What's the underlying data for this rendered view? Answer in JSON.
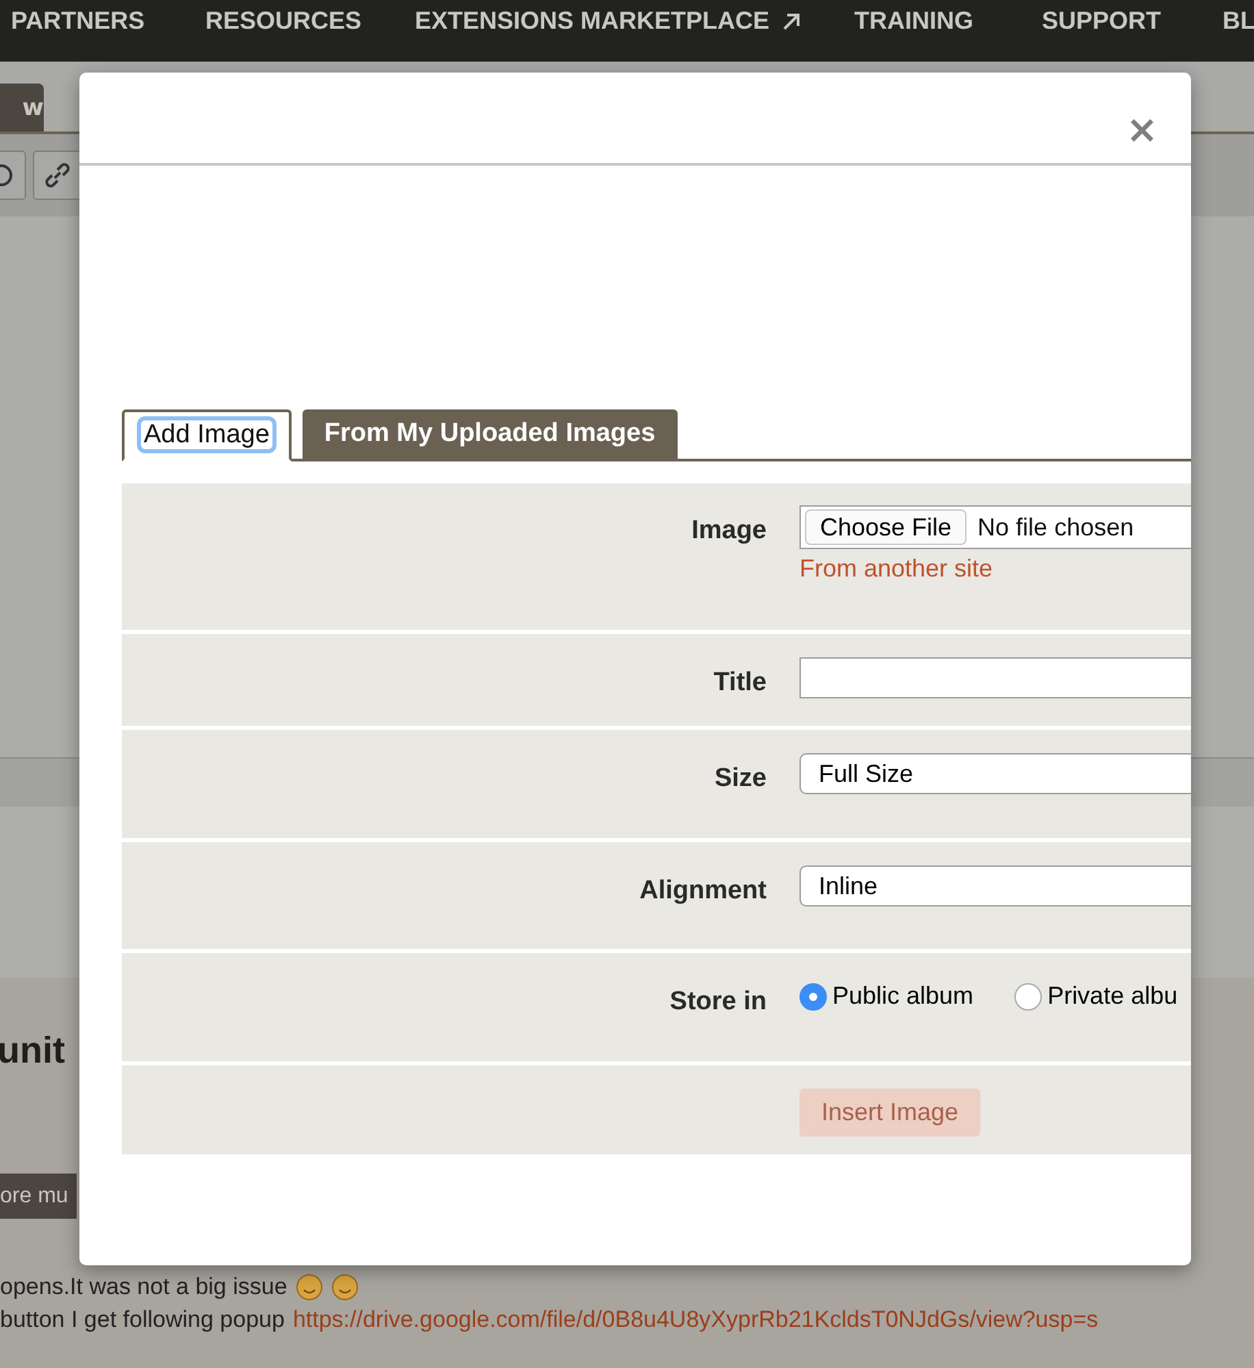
{
  "nav": {
    "items": [
      {
        "label": "PARTNERS",
        "kind": "plain"
      },
      {
        "label": "RESOURCES",
        "kind": "plain"
      },
      {
        "label": "EXTENSIONS MARKETPLACE",
        "kind": "external"
      },
      {
        "label": "TRAINING",
        "kind": "plain"
      },
      {
        "label": "SUPPORT",
        "kind": "plain"
      },
      {
        "label": "BL",
        "kind": "plain"
      }
    ]
  },
  "background": {
    "tab": "w",
    "heading": "unit",
    "button": "ore mu",
    "lines": [
      {
        "text": "opens.It was not a big issue",
        "emojis": [
          {
            "kind": "smiley"
          },
          {
            "kind": "smiley"
          }
        ]
      },
      {
        "text": "button I get following popup",
        "link": "https://drive.google.com/file/d/0B8u4U8yXyprRb21KcldsT0NJdGs/view?usp=s"
      }
    ]
  },
  "modal": {
    "close": "×",
    "tabs": [
      {
        "label": "Add Image",
        "selected": true
      },
      {
        "label": "From My Uploaded Images",
        "selected": false
      }
    ],
    "fields": [
      {
        "kind": "file",
        "label": "Image",
        "button": "Choose File",
        "value": "No file chosen",
        "link": "From another site"
      },
      {
        "kind": "text",
        "label": "Title"
      },
      {
        "kind": "select",
        "label": "Size",
        "value": "Full Size"
      },
      {
        "kind": "select",
        "label": "Alignment",
        "value": "Inline"
      },
      {
        "kind": "radio",
        "label": "Store in",
        "options": [
          {
            "label": "Public album",
            "selected": true
          },
          {
            "label": "Private albu",
            "selected": false
          }
        ]
      }
    ],
    "submit": {
      "label": "Insert Image",
      "disabled": true
    }
  }
}
